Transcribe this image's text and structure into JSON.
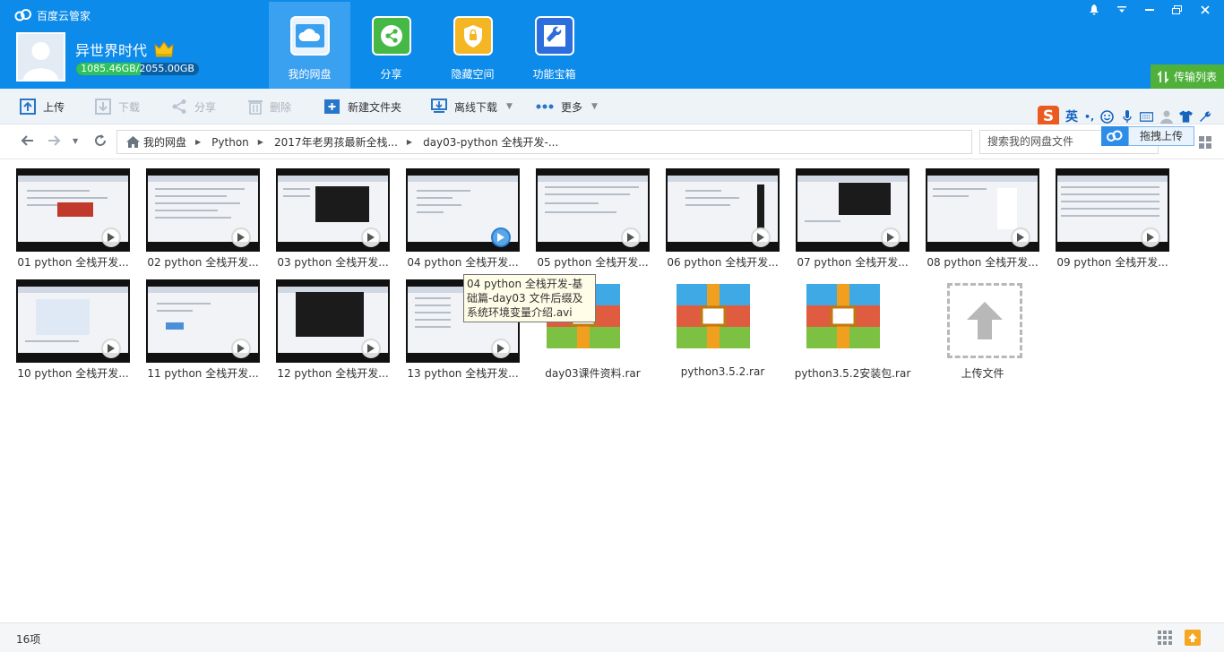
{
  "app": {
    "title": "百度云管家"
  },
  "user": {
    "name": "异世界时代",
    "quota": "1085.46GB/2055.00GB",
    "quota_fraction": 0.528
  },
  "nav": [
    {
      "label": "我的网盘",
      "icon": "cloud-icon",
      "color": "#3aa0f0"
    },
    {
      "label": "分享",
      "icon": "share-icon",
      "color": "#45b845"
    },
    {
      "label": "隐藏空间",
      "icon": "lock-icon",
      "color": "#f5b623"
    },
    {
      "label": "功能宝箱",
      "icon": "wrench-icon",
      "color": "#2e6ddc"
    }
  ],
  "window": {
    "transfer_label": "传输列表"
  },
  "toolbar": {
    "upload": "上传",
    "download": "下载",
    "share": "分享",
    "delete": "删除",
    "new_folder": "新建文件夹",
    "offline_download": "离线下载",
    "more": "更多"
  },
  "ime": {
    "lang": "英",
    "punct": "•,"
  },
  "breadcrumb": [
    {
      "label": "我的网盘"
    },
    {
      "label": "Python"
    },
    {
      "label": "2017年老男孩最新全栈..."
    },
    {
      "label": "day03-python 全栈开发-..."
    }
  ],
  "search": {
    "placeholder": "搜索我的网盘文件"
  },
  "upload_tip": {
    "label": "拖拽上传"
  },
  "files": [
    {
      "name": "01 python 全栈开发...",
      "type": "video"
    },
    {
      "name": "02 python 全栈开发...",
      "type": "video"
    },
    {
      "name": "03 python 全栈开发...",
      "type": "video"
    },
    {
      "name": "04 python 全栈开发...",
      "type": "video"
    },
    {
      "name": "05 python 全栈开发...",
      "type": "video"
    },
    {
      "name": "06 python 全栈开发...",
      "type": "video"
    },
    {
      "name": "07 python 全栈开发...",
      "type": "video"
    },
    {
      "name": "08 python 全栈开发...",
      "type": "video"
    },
    {
      "name": "09 python 全栈开发...",
      "type": "video"
    },
    {
      "name": "10 python 全栈开发...",
      "type": "video"
    },
    {
      "name": "11 python 全栈开发...",
      "type": "video"
    },
    {
      "name": "12 python 全栈开发...",
      "type": "video"
    },
    {
      "name": "13 python 全栈开发...",
      "type": "video"
    },
    {
      "name": "day03课件资料.rar",
      "type": "rar"
    },
    {
      "name": "python3.5.2.rar",
      "type": "rar"
    },
    {
      "name": "python3.5.2安装包.rar",
      "type": "rar"
    },
    {
      "name": "上传文件",
      "type": "upload"
    }
  ],
  "tooltip": {
    "text": "04 python 全栈开发-基础篇-day03 文件后缀及系统环境变量介绍.avi"
  },
  "status": {
    "count": "16项"
  }
}
